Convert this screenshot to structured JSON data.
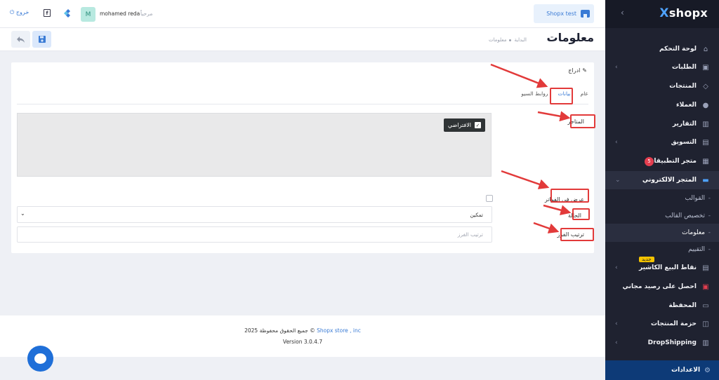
{
  "sidebar": {
    "logo": "shopx",
    "items": [
      {
        "label": "لوحة التحكم",
        "icon": "home-icon"
      },
      {
        "label": "الطلبات",
        "icon": "inbox-icon"
      },
      {
        "label": "المنتجات",
        "icon": "tag-icon"
      },
      {
        "label": "العملاء",
        "icon": "user-icon"
      },
      {
        "label": "التقارير",
        "icon": "bar-chart-icon"
      },
      {
        "label": "التسويق",
        "icon": "calendar-icon"
      },
      {
        "label": "متجر التطبيقات",
        "icon": "grid-icon",
        "badge": "5"
      },
      {
        "label": "المتجر الالكتروني",
        "icon": "store-icon"
      },
      {
        "label": "القوالب"
      },
      {
        "label": "تخصيص القالب"
      },
      {
        "label": "معلومات"
      },
      {
        "label": "التقييم"
      },
      {
        "label": "نقاط البيع الكاشير",
        "icon": "pos-icon",
        "badge_new": "جديد"
      },
      {
        "label": "احصل على رصيد مجاني",
        "icon": "gift-icon"
      },
      {
        "label": "المحفظة",
        "icon": "wallet-icon"
      },
      {
        "label": "حزمة المنتجات",
        "icon": "box-icon"
      },
      {
        "label": "DropShipping",
        "icon": "boxes-icon"
      }
    ],
    "settings_label": "الاعدادات"
  },
  "topbar": {
    "store_name": "Shopx test",
    "logout_label": "خروج",
    "avatar_letter": "M",
    "username": "mohamed reda",
    "greeting": "مرحباً"
  },
  "page": {
    "title": "معلومات",
    "breadcrumb_home": "البداية",
    "breadcrumb_current": "معلومات"
  },
  "card": {
    "title": "ادراج",
    "tabs": [
      "عام",
      "بيانات",
      "روابط السيو"
    ],
    "store_label": "المتاجر",
    "store_tag": "الافتراضي",
    "invoice_label": "عرض في الفواتر",
    "status_label": "الحالة",
    "status_value": "تمكين",
    "order_label": "ترتيب الفرز",
    "order_placeholder": "ترتيب الفرز"
  },
  "footer": {
    "copyright_prefix": "جميع الحقوق محفوظة 2025 ©",
    "copyright_link": "Shopx store , inc",
    "version": "Version 3.0.4.7"
  },
  "colors": {
    "accent": "#3a7bd5",
    "sidebar_bg": "#1f2230",
    "annotation": "#e23a3a",
    "settings_bg": "#0d3a77"
  }
}
